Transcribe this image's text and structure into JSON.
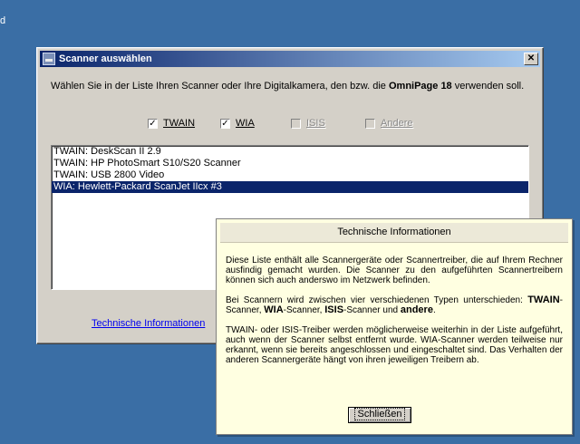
{
  "desktop": {
    "corner_text": "d"
  },
  "dialog": {
    "title": "Scanner auswählen",
    "close_glyph": "✕",
    "intro_part1": "Wählen Sie in der Liste Ihren Scanner oder Ihre Digitalkamera, den bzw. die ",
    "intro_product": "OmniPage 18",
    "intro_part2": " verwenden soll.",
    "filters": [
      {
        "label": "TWAIN",
        "checked": true,
        "enabled": true
      },
      {
        "label": "WIA",
        "checked": true,
        "enabled": true
      },
      {
        "label": "ISIS",
        "checked": false,
        "enabled": false
      },
      {
        "label": "Andere",
        "checked": false,
        "enabled": false
      }
    ],
    "list": [
      "TWAIN: DeskScan II 2.9",
      "TWAIN: HP PhotoSmart S10/S20 Scanner",
      "TWAIN: USB 2800 Video",
      "WIA: Hewlett-Packard ScanJet IIcx #3"
    ],
    "selected_index": 3,
    "tech_link": "Technische Informationen"
  },
  "popup": {
    "title": "Technische Informationen",
    "p1": "Diese Liste enthält alle Scannergeräte oder Scannertreiber, die auf Ihrem Rechner ausfindig gemacht wurden. Die Scanner zu den aufgeführten Scannertreibern können sich auch anderswo im Netzwerk befinden.",
    "p2_intro": "Bei Scannern wird zwischen vier verschiedenen Typen unterschieden: ",
    "p2_twain": "TWAIN",
    "p2_twain_suffix": "-Scanner, ",
    "p2_wia": "WIA",
    "p2_wia_suffix": "-Scanner, ",
    "p2_isis": "ISIS",
    "p2_isis_suffix": "-Scanner und ",
    "p2_andere": "andere",
    "p2_end": ".",
    "p3": "TWAIN- oder ISIS-Treiber werden möglicherweise weiterhin in der Liste aufgeführt, auch wenn der Scanner selbst entfernt wurde. WIA-Scanner werden teilweise nur erkannt, wenn sie bereits angeschlossen und eingeschaltet sind. Das Verhalten der anderen Scannergeräte hängt von ihren jeweiligen Treibern ab.",
    "close_label": "Schließen"
  }
}
